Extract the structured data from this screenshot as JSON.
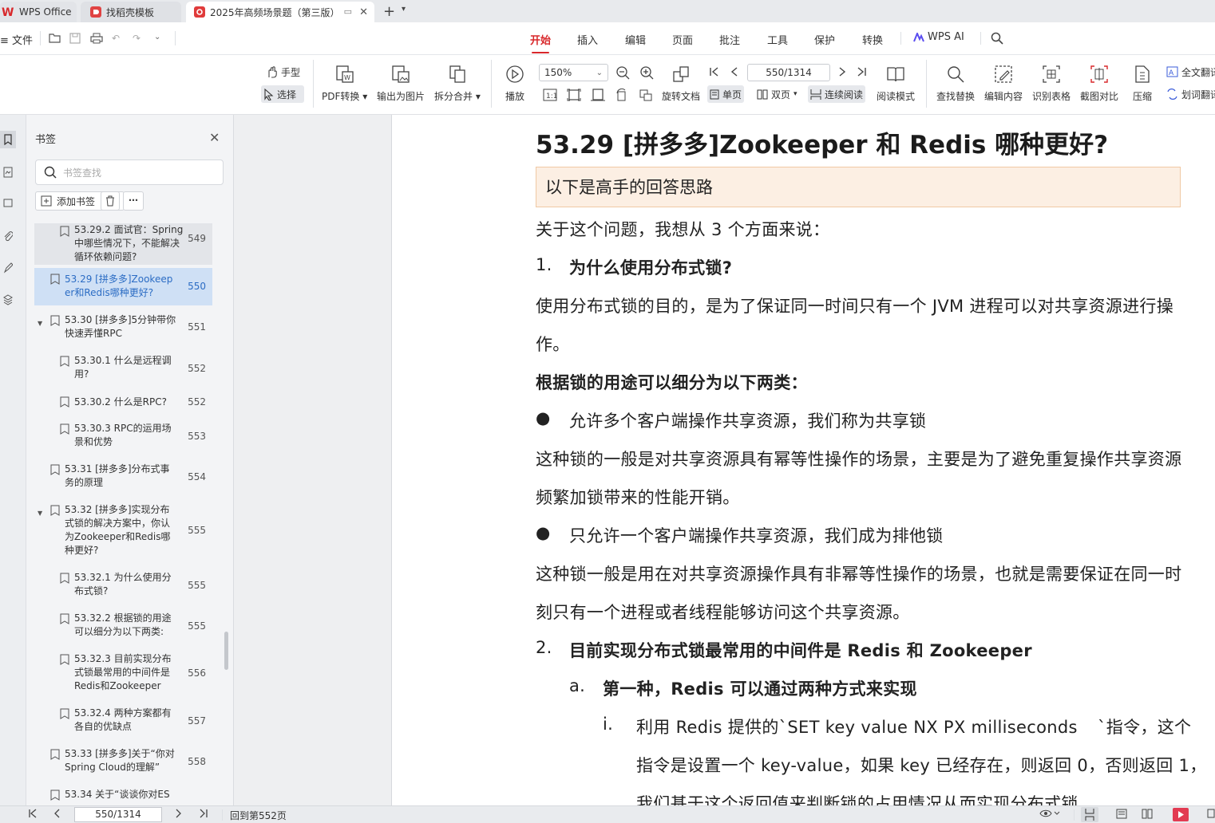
{
  "tabs": {
    "wps": "WPS Office",
    "docer": "找稻壳模板",
    "doc": "2025年高频场景题（第三版）"
  },
  "menu": {
    "file": "文件",
    "items": [
      "开始",
      "插入",
      "编辑",
      "页面",
      "批注",
      "工具",
      "保护",
      "转换"
    ],
    "active": "开始",
    "wps_ai": "WPS AI"
  },
  "ribbon": {
    "hand": "手型",
    "select": "选择",
    "pdf_convert": "PDF转换",
    "export_image": "输出为图片",
    "split_merge": "拆分合并",
    "play": "播放",
    "zoom": "150%",
    "page_input": "550/1314",
    "rotate": "旋转文档",
    "single": "单页",
    "double": "双页",
    "continuous": "连续阅读",
    "read_mode": "阅读模式",
    "find_replace": "查找替换",
    "edit_content": "编辑内容",
    "recognize_table": "识别表格",
    "screenshot_compare": "截图对比",
    "compress": "压缩",
    "full_translate": "全文翻译",
    "word_translate": "划词翻译"
  },
  "panel": {
    "title": "书签",
    "search_placeholder": "书签查找",
    "add_label": "添加书签",
    "items": [
      {
        "text": "53.29.2 面试官：Spring中哪些情况下，不能解决循环依赖问题?",
        "page": "549"
      },
      {
        "text": "53.29 [拼多多]Zookeeper和Redis哪种更好?",
        "page": "550"
      },
      {
        "text": "53.30 [拼多多]5分钟带你快速弄懂RPC",
        "page": "551"
      },
      {
        "text": "53.30.1 什么是远程调用?",
        "page": "552"
      },
      {
        "text": "53.30.2 什么是RPC?",
        "page": "552"
      },
      {
        "text": "53.30.3 RPC的运用场景和优势",
        "page": "553"
      },
      {
        "text": "53.31 [拼多多]分布式事务的原理",
        "page": "554"
      },
      {
        "text": "53.32 [拼多多]实现分布式锁的解决方案中，你认为Zookeeper和Redis哪种更好?",
        "page": "555"
      },
      {
        "text": "53.32.1 为什么使用分布式锁?",
        "page": "555"
      },
      {
        "text": "53.32.2 根据锁的用途可以细分为以下两类:",
        "page": "555"
      },
      {
        "text": "53.32.3 目前实现分布式锁最常用的中间件是Redis和Zookeeper",
        "page": "556"
      },
      {
        "text": "53.32.4 两种方案都有各自的优缺点",
        "page": "557"
      },
      {
        "text": "53.33 [拼多多]关于“你对Spring Cloud的理解”",
        "page": "558"
      },
      {
        "text": "53.34 关于“谈谈你对ES",
        "page": ""
      }
    ]
  },
  "doc": {
    "heading": "53.29 [拼多多]Zookeeper 和 Redis 哪种更好?",
    "note": "以下是高手的回答思路",
    "p_intro": "关于这个问题，我想从 3 个方面来说：",
    "n1": "1.",
    "h1": "为什么使用分布式锁?",
    "p1a": "使用分布式锁的目的，是为了保证同一时间只有一个 JVM 进程可以对共享资源进行操",
    "p1b": "作。",
    "h_types": "根据锁的用途可以细分为以下两类：",
    "bullet1": "允许多个客户端操作共享资源，我们称为共享锁",
    "p2a": "这种锁的一般是对共享资源具有幂等性操作的场景，主要是为了避免重复操作共享资源",
    "p2b": "频繁加锁带来的性能开销。",
    "bullet2": "只允许一个客户端操作共享资源，我们成为排他锁",
    "p3a": "这种锁一般是用在对共享资源操作具有非幂等性操作的场景，也就是需要保证在同一时",
    "p3b": "刻只有一个进程或者线程能够访问这个共享资源。",
    "n2": "2.",
    "h2": "目前实现分布式锁最常用的中间件是 Redis 和 Zookeeper",
    "na": "a.",
    "ha": "第一种，Redis 可以通过两种方式来实现",
    "ni": "i.",
    "pi1": "利用 Redis 提供的`SET key value NX PX milliseconds",
    "pi1b": "`指令，这个",
    "pi2": "指令是设置一个 key-value，如果 key 已经存在，则返回 0，否则返回 1，",
    "pi3": "我们基于这个返回值来判断锁的占用情况从而实现分布式锁"
  },
  "status": {
    "page": "550/1314",
    "back": "回到第552页"
  }
}
